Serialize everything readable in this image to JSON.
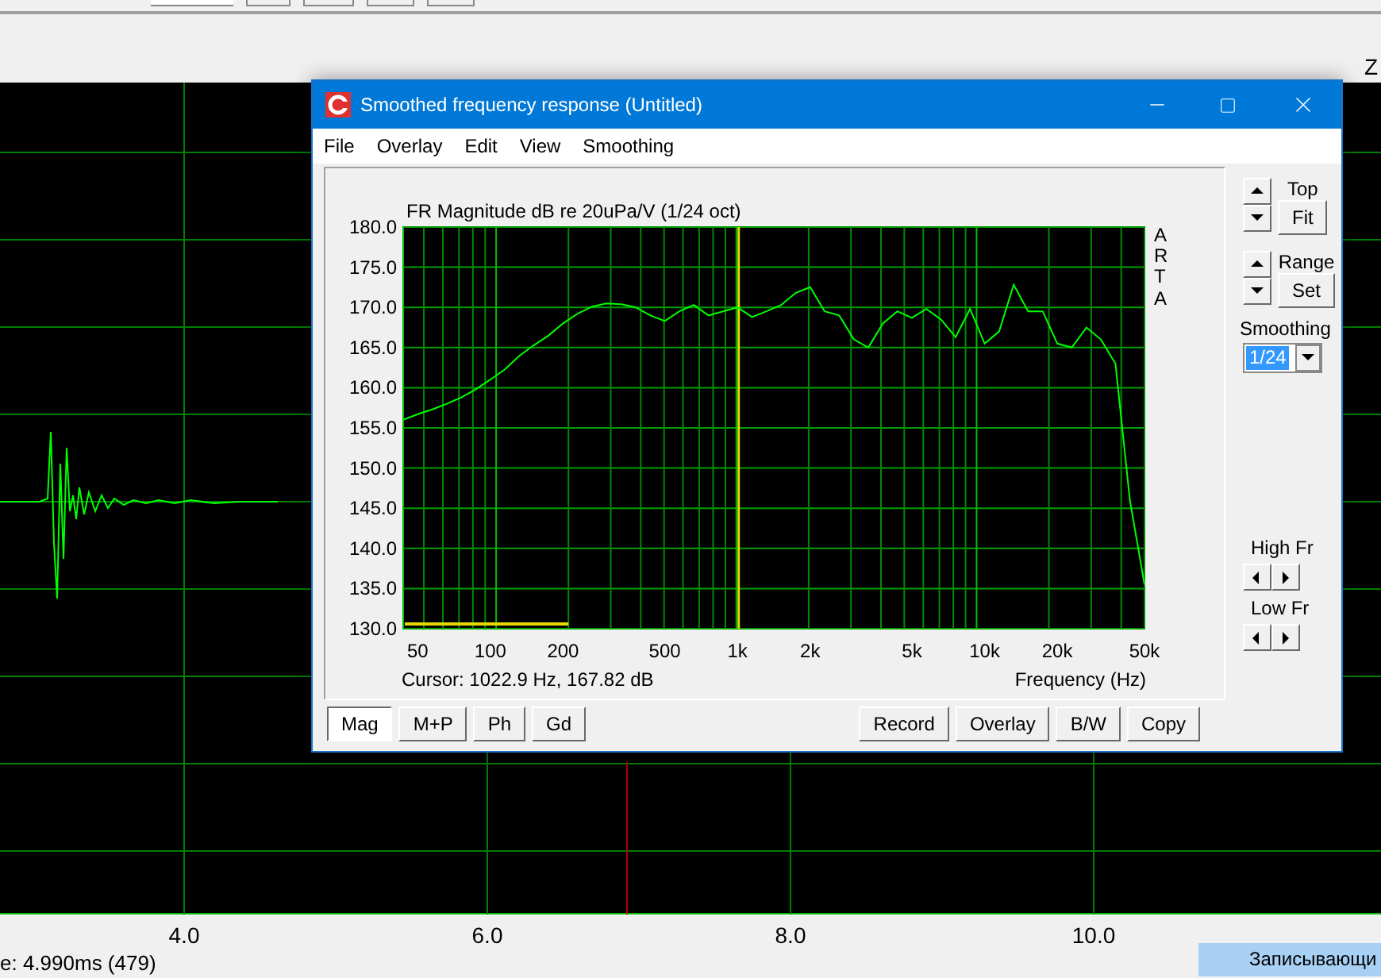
{
  "main_window": {
    "toolbar_label": "Z",
    "impulse_axis_labels": [
      "4.0",
      "6.0",
      "8.0",
      "10.0"
    ],
    "status": "e: 4.990ms (479)"
  },
  "notification": "Записывающи",
  "dialog": {
    "title": "Smoothed frequency response (Untitled)",
    "menu": [
      "File",
      "Overlay",
      "Edit",
      "View",
      "Smoothing"
    ],
    "chart_data": {
      "type": "line",
      "title": "FR Magnitude dB re 20uPa/V (1/24 oct)",
      "xlabel": "Frequency (Hz)",
      "ylim": [
        130,
        180
      ],
      "grid": true,
      "categories": [
        null,
        "50",
        null,
        null,
        null,
        null,
        "100",
        null,
        null,
        null,
        null,
        "200",
        null,
        null,
        null,
        null,
        null,
        null,
        "500",
        null,
        null,
        null,
        null,
        "1k",
        null,
        null,
        null,
        null,
        "2k",
        null,
        null,
        null,
        null,
        null,
        null,
        "5k",
        null,
        null,
        null,
        null,
        "10k",
        null,
        null,
        null,
        null,
        "20k",
        null,
        null,
        null,
        null,
        null,
        "50k"
      ],
      "yticks": [
        {
          "value": 130,
          "label": "130.0"
        },
        {
          "value": 135,
          "label": "135.0"
        },
        {
          "value": 140,
          "label": "140.0"
        },
        {
          "value": 145,
          "label": "145.0"
        },
        {
          "value": 150,
          "label": "150.0"
        },
        {
          "value": 155,
          "label": "155.0"
        },
        {
          "value": 160,
          "label": "160.0"
        },
        {
          "value": 165,
          "label": "165.0"
        },
        {
          "value": 170,
          "label": "170.0"
        },
        {
          "value": 175,
          "label": "175.0"
        },
        {
          "value": 180,
          "label": "180.0"
        }
      ],
      "series": [
        {
          "color": "#00ff00",
          "values": [
            156,
            156.7,
            157.3,
            158,
            158.8,
            159.8,
            161,
            162.3,
            164,
            165.3,
            166.5,
            168,
            169.2,
            170.1,
            170.5,
            170.4,
            170,
            169,
            168.3,
            169.5,
            170.3,
            169,
            169.5,
            170,
            168.8,
            169.5,
            170.3,
            171.8,
            172.5,
            169.5,
            169,
            166,
            165,
            168,
            169.5,
            168.7,
            169.8,
            168.5,
            166.3,
            169.8,
            165.5,
            167,
            172.8,
            169.5,
            169.5,
            165.5,
            165,
            167.5,
            166,
            163,
            146,
            135.5
          ]
        }
      ]
    },
    "cursor_readout": "Cursor: 1022.9 Hz, 167.82 dB",
    "logo_text": "ARTA",
    "side_controls": {
      "top_label": "Top",
      "fit_button": "Fit",
      "range_label": "Range",
      "set_button": "Set",
      "smoothing_label": "Smoothing",
      "smoothing_value": "1/24",
      "high_fr_label": "High Fr",
      "low_fr_label": "Low Fr"
    },
    "view_buttons": [
      {
        "label": "Mag",
        "selected": true
      },
      {
        "label": "M+P",
        "selected": false
      },
      {
        "label": "Ph",
        "selected": false
      },
      {
        "label": "Gd",
        "selected": false
      }
    ],
    "action_buttons": [
      "Record",
      "Overlay",
      "B/W",
      "Copy"
    ]
  }
}
